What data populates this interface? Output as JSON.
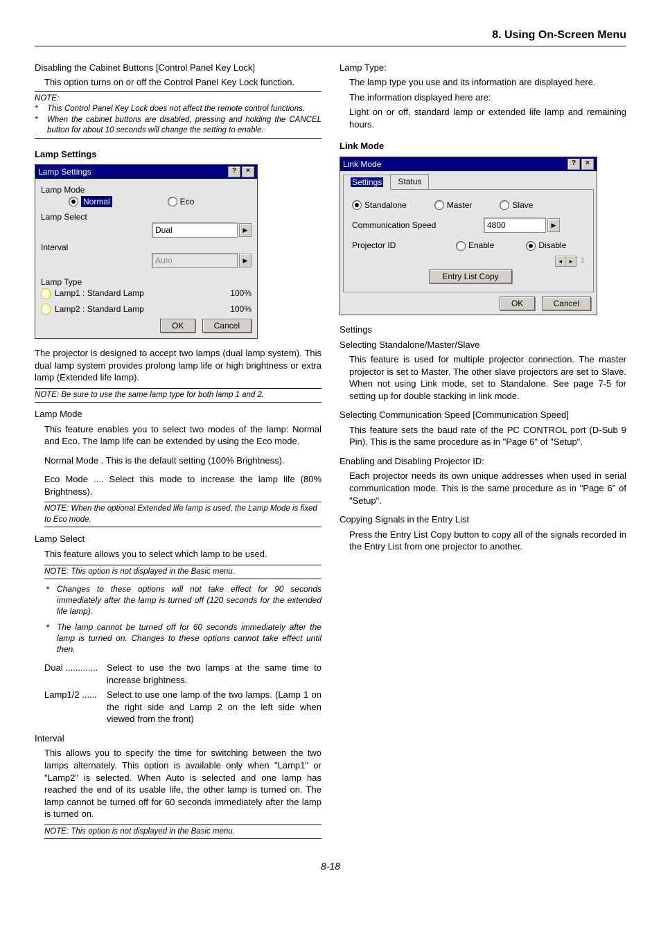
{
  "header": {
    "chapter": "8. Using On-Screen Menu"
  },
  "left": {
    "disable_title": "Disabling the Cabinet Buttons [Control Panel Key Lock]",
    "disable_desc": "This option turns on or off the Control Panel Key Lock function.",
    "note_label": "NOTE:",
    "note1": "This Control Panel Key Lock does not affect the remote control functions.",
    "note2": "When the cabinet buttons are disabled, pressing and holding the CANCEL button for about 10 seconds will change the setting to enable.",
    "lamp_settings_heading": "Lamp Settings",
    "dlg1": {
      "title": "Lamp Settings",
      "lamp_mode_label": "Lamp Mode",
      "normal": "Normal",
      "eco": "Eco",
      "lamp_select_label": "Lamp Select",
      "lamp_select_value": "Dual",
      "interval_label": "Interval",
      "interval_value": "Auto",
      "lamp_type_label": "Lamp Type",
      "lamp1": "Lamp1 : Standard Lamp",
      "lamp1_pct": "100%",
      "lamp2": "Lamp2 : Standard Lamp",
      "lamp2_pct": "100%",
      "ok": "OK",
      "cancel": "Cancel"
    },
    "para1": "The projector is designed to accept two lamps (dual lamp system). This dual lamp system provides prolong lamp life or high brightness or extra lamp (Extended life lamp).",
    "note3": "NOTE: Be sure to use the same lamp type for both lamp 1 and 2.",
    "lamp_mode_h": "Lamp Mode",
    "lamp_mode_p": "This feature enables you to select two modes of the lamp: Normal and Eco. The lamp life can be extended by using the Eco mode.",
    "normal_mode": "Normal Mode . This is the default setting (100% Brightness).",
    "eco_mode": "Eco Mode .... Select this mode to increase the lamp life (80% Brightness).",
    "note4": "NOTE: When the optional Extended life lamp is used, the Lamp Mode is fixed to Eco mode.",
    "lamp_select_h": "Lamp Select",
    "lamp_select_p": "This feature allows you to select which lamp to be used.",
    "note5": "NOTE: This option is not displayed in the Basic menu.",
    "star1": "Changes to these options will not take effect for 90 seconds immediately after the lamp is turned off (120 seconds for the extended life lamp).",
    "star2": "The lamp cannot be turned off for 60 seconds immediately after the lamp is turned on. Changes to these options cannot take effect until then.",
    "dual_term": "Dual .............",
    "dual_def": "Select to use the two lamps at the same time to increase brightness.",
    "lamp12_term": "Lamp1/2 ......",
    "lamp12_def": "Select to use one lamp of the two lamps. (Lamp 1 on the right side and Lamp 2 on the left side when viewed from the front)",
    "interval_h": "Interval",
    "interval_p": "This allows you to specify the time for switching between the two lamps alternately. This option is available only when \"Lamp1\" or \"Lamp2\" is selected. When Auto is selected and one lamp has reached the end of its usable life, the other lamp is turned on. The lamp cannot be turned off for 60 seconds immediately after the lamp is turned on.",
    "note6": "NOTE: This option is not displayed in the Basic menu."
  },
  "right": {
    "lamp_type_h": "Lamp Type:",
    "lamp_type_p1": "The lamp type you use and its information are displayed here.",
    "lamp_type_p2": "The information displayed here are:",
    "lamp_type_p3": "Light on or off, standard lamp or extended life lamp and remaining hours.",
    "link_mode_heading": "Link Mode",
    "dlg2": {
      "title": "Link Mode",
      "tab_settings": "Settings",
      "tab_status": "Status",
      "standalone": "Standalone",
      "master": "Master",
      "slave": "Slave",
      "comm_speed_label": "Communication Speed",
      "comm_speed_value": "4800",
      "projector_id_label": "Projector ID",
      "enable": "Enable",
      "disable": "Disable",
      "entry_copy": "Entry List Copy",
      "ok": "OK",
      "cancel": "Cancel"
    },
    "settings_h": "Settings",
    "sel_h": "Selecting Standalone/Master/Slave",
    "sel_p": "This feature is used for multiple projector connection. The master projector is set to Master. The other slave projectors are set to Slave. When not using Link mode, set to Standalone. See page 7-5 for setting up for double stacking in link mode.",
    "comm_h": "Selecting Communication Speed [Communication Speed]",
    "comm_p": "This feature sets the baud rate of the PC CONTROL port (D-Sub 9 Pin). This is the same procedure as in \"Page 6\" of \"Setup\".",
    "pid_h": "Enabling and Disabling Projector ID:",
    "pid_p": "Each projector needs its own unique addresses when used in serial communication mode. This is the same procedure as in \"Page 6\" of \"Setup\".",
    "copy_h": "Copying Signals in the Entry List",
    "copy_p": "Press the Entry List Copy button to copy all of the signals recorded in the Entry List from one projector to another."
  },
  "pagenum": "8-18"
}
